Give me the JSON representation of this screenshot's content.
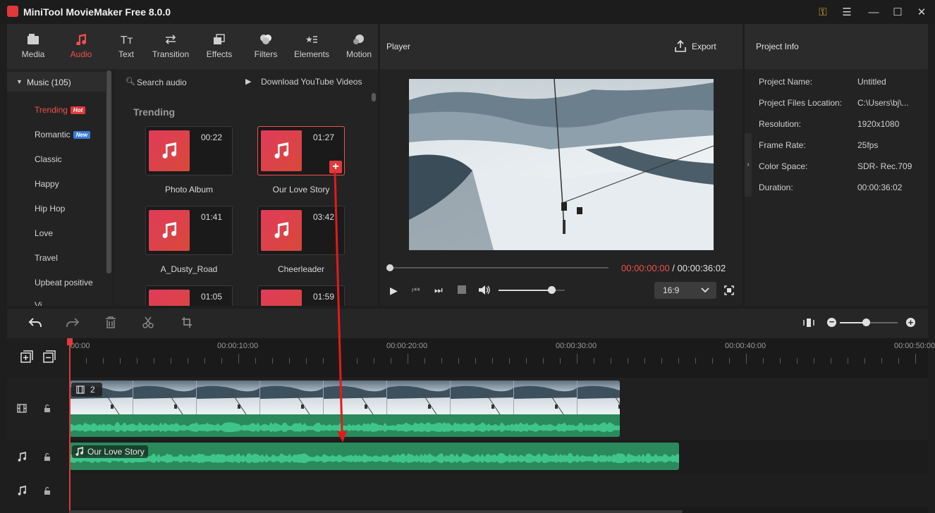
{
  "app": {
    "title": "MiniTool MovieMaker Free 8.0.0"
  },
  "toolbar": {
    "tabs": [
      {
        "label": "Media"
      },
      {
        "label": "Audio"
      },
      {
        "label": "Text"
      },
      {
        "label": "Transition"
      },
      {
        "label": "Effects"
      },
      {
        "label": "Filters"
      },
      {
        "label": "Elements"
      },
      {
        "label": "Motion"
      }
    ],
    "active": "Audio",
    "accent": "#ef4f4f"
  },
  "library": {
    "header": "Music (105)",
    "categories": [
      {
        "label": "Trending",
        "badge": "Hot",
        "badge_color": "#e0393d"
      },
      {
        "label": "Romantic",
        "badge": "New",
        "badge_color": "#3a7bd5"
      },
      {
        "label": "Classic"
      },
      {
        "label": "Happy"
      },
      {
        "label": "Hip Hop"
      },
      {
        "label": "Love"
      },
      {
        "label": "Travel"
      },
      {
        "label": "Upbeat positive"
      },
      {
        "label": "Vi..."
      }
    ]
  },
  "audio_panel": {
    "search_placeholder": "Search audio",
    "download_label": "Download YouTube Videos",
    "section": "Trending",
    "items": [
      {
        "name": "Photo Album",
        "duration": "00:22"
      },
      {
        "name": "Our Love Story",
        "duration": "01:27"
      },
      {
        "name": "A_Dusty_Road",
        "duration": "01:41"
      },
      {
        "name": "Cheerleader",
        "duration": "03:42"
      },
      {
        "name": "",
        "duration": "01:05"
      },
      {
        "name": "",
        "duration": "01:59"
      }
    ]
  },
  "player": {
    "title": "Player",
    "export_label": "Export",
    "current_time": "00:00:00:00",
    "separator": " / ",
    "total_time": "00:00:36:02",
    "aspect": "16:9",
    "volume_fraction": 0.8,
    "progress_fraction": 0
  },
  "project_info": {
    "title": "Project Info",
    "fields": [
      {
        "key": "Project Name:",
        "value": "Untitled"
      },
      {
        "key": "Project Files Location:",
        "value": "C:\\Users\\bj\\..."
      },
      {
        "key": "Resolution:",
        "value": "1920x1080"
      },
      {
        "key": "Frame Rate:",
        "value": "25fps"
      },
      {
        "key": "Color Space:",
        "value": "SDR- Rec.709"
      },
      {
        "key": "Duration:",
        "value": "00:00:36:02"
      }
    ]
  },
  "timeline": {
    "ruler": [
      "00:00",
      "00:00:10:00",
      "00:00:20:00",
      "00:00:30:00",
      "00:00:40:00",
      "00:00:50:00"
    ],
    "video_clip_count": "2",
    "audio_clip_name": "Our Love Story",
    "zoom_fraction": 0.45
  }
}
